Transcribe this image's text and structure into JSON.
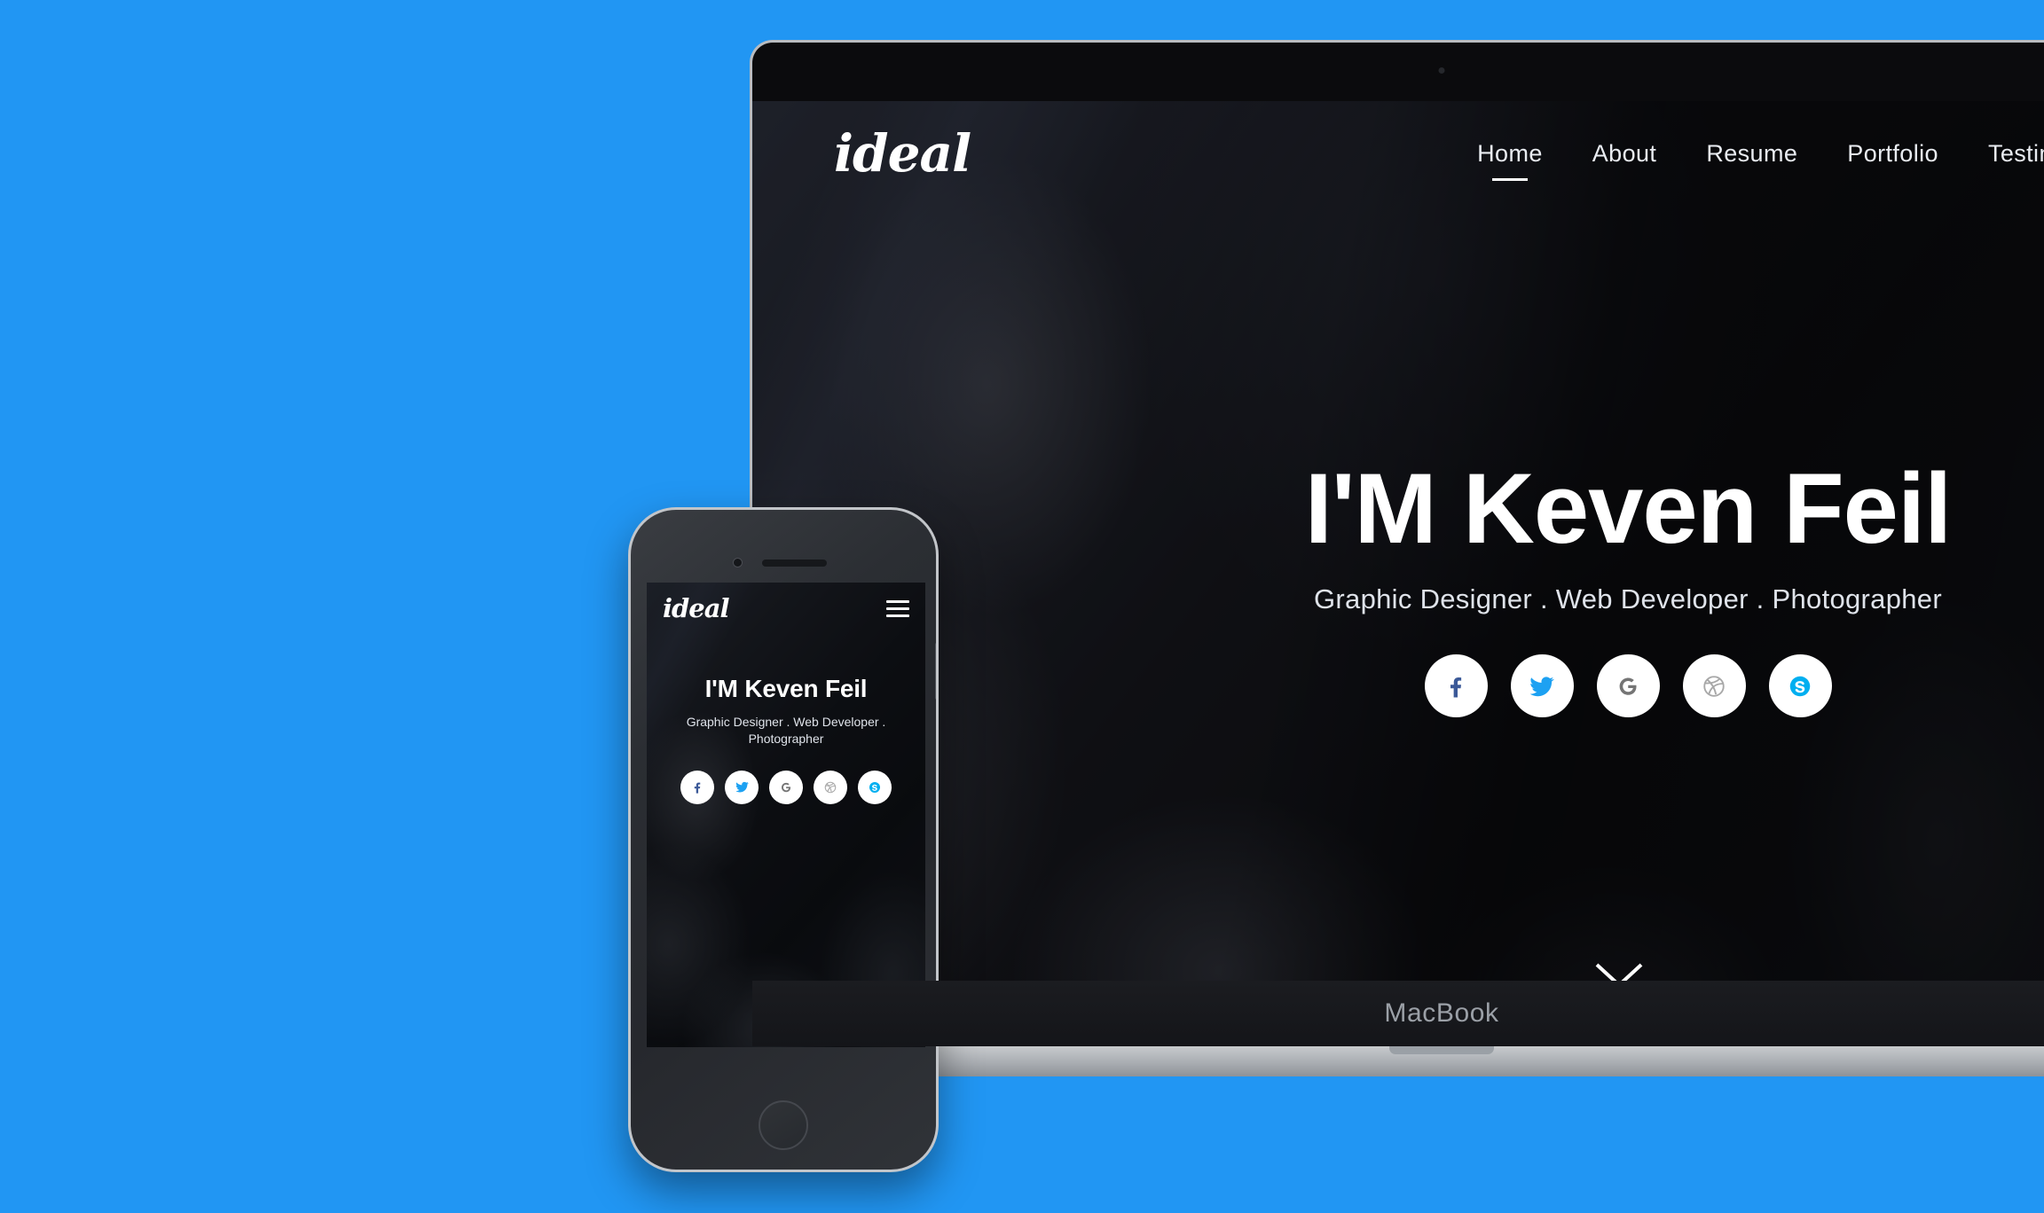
{
  "background_color": "#2196f3",
  "laptop": {
    "device_label": "MacBook",
    "site": {
      "logo": "ideal",
      "nav": [
        {
          "label": "Home",
          "active": true
        },
        {
          "label": "About",
          "active": false
        },
        {
          "label": "Resume",
          "active": false
        },
        {
          "label": "Portfolio",
          "active": false
        },
        {
          "label": "Testimonia",
          "active": false
        }
      ],
      "hero": {
        "title": "I'M Keven Feil",
        "subtitle": "Graphic Designer . Web Developer . Photographer"
      },
      "socials": [
        {
          "name": "facebook",
          "color": "#3b5998"
        },
        {
          "name": "twitter",
          "color": "#1da1f2"
        },
        {
          "name": "google",
          "color": "#757575"
        },
        {
          "name": "dribbble",
          "color": "#a8a8a8"
        },
        {
          "name": "skype",
          "color": "#00aff0"
        }
      ],
      "scroll_indicator": "chevron-down"
    }
  },
  "phone": {
    "site": {
      "logo": "ideal",
      "menu_icon": "hamburger-icon",
      "hero": {
        "title": "I'M Keven Feil",
        "subtitle": "Graphic Designer . Web Developer . Photographer"
      },
      "socials": [
        {
          "name": "facebook",
          "color": "#3b5998"
        },
        {
          "name": "twitter",
          "color": "#1da1f2"
        },
        {
          "name": "google",
          "color": "#757575"
        },
        {
          "name": "dribbble",
          "color": "#a8a8a8"
        },
        {
          "name": "skype",
          "color": "#00aff0"
        }
      ],
      "scroll_indicator": "chevron-down"
    }
  }
}
